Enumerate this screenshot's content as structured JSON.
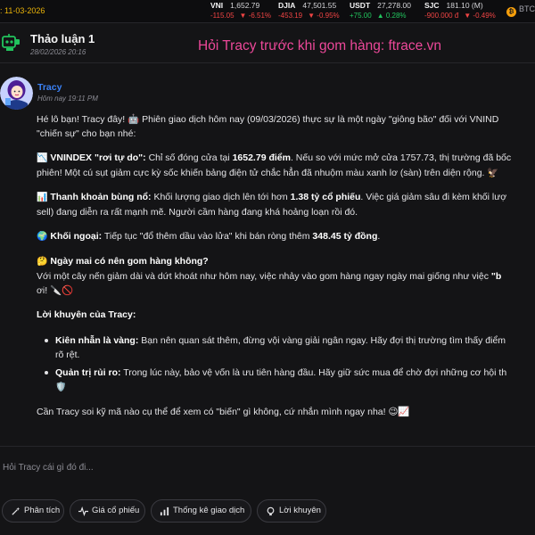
{
  "ticker": {
    "date": ": 11-03-2026",
    "items": [
      {
        "symbol": "VNI",
        "price": "1,652.79",
        "change": "-115.05",
        "pct": "▼ -6.51%",
        "direction": "down"
      },
      {
        "symbol": "DJIA",
        "price": "47,501.55",
        "change": "-453.19",
        "pct": "▼ -0.95%",
        "direction": "down"
      },
      {
        "symbol": "USDT",
        "price": "27,278.00",
        "change": "+75.00",
        "pct": "▲ 0.28%",
        "direction": "up"
      },
      {
        "symbol": "SJC",
        "price": "181.10 (M)",
        "change": "-900.000 đ",
        "pct": "▼ -0.49%",
        "direction": "down"
      }
    ],
    "btc_label": "BTC"
  },
  "header": {
    "title": "Thảo luận 1",
    "date": "28/02/2026 20:16",
    "promo": "Hỏi Tracy trước khi gom hàng:  ftrace.vn"
  },
  "message": {
    "sender": "Tracy",
    "time": "Hôm nay 19:11 PM",
    "intro_1": "Hé lô bạn! Tracy đây! 🤖 Phiên giao dịch hôm nay (09/03/2026) thực sự là một ngày \"giông bão\" đối với VNIND",
    "intro_2": "\"chiến sự\" cho bạn nhé:",
    "vnindex": {
      "icon": "📉",
      "label": "VNINDEX \"rơi tự do\":",
      "t1": " Chỉ số đóng cửa tại ",
      "value": "1652.79 điểm",
      "t2": ". Nếu so với mức mở cửa 1757.73, thị trường đã bốc",
      "line2": "phiên! Một cú sụt giảm cực kỳ sốc khiến bảng điện tử chắc hẳn đã nhuộm màu xanh lơ (sàn) trên diện rộng. 🦅"
    },
    "liquidity": {
      "icon": "📊",
      "label": "Thanh khoản bùng nổ:",
      "t1": " Khối lượng giao dịch lên tới hơn ",
      "value": "1.38 tỷ cổ phiếu",
      "t2": ". Việc giá giảm sâu đi kèm khối lượ",
      "line2": "sell) đang diễn ra rất mạnh mẽ. Người cầm hàng đang khá hoảng loạn rồi đó."
    },
    "foreign": {
      "icon": "🌍",
      "label": "Khối ngoại:",
      "t1": " Tiếp tục \"đổ thêm dầu vào lửa\" khi bán ròng thêm ",
      "value": "348.45 tỷ đồng",
      "t2": "."
    },
    "question": {
      "icon": "🤔",
      "label": "Ngày mai có nên gom hàng không?",
      "line1": "Với một cây nến giảm dài và dứt khoát như hôm nay, việc nhảy vào gom hàng ngay ngày mai giống như việc ",
      "bold_tail": "\"b",
      "line2": "ơi! 🔪🚫"
    },
    "advice_title": "Lời khuyên của Tracy:",
    "advice": [
      {
        "label": "Kiên nhẫn là vàng:",
        "line1": " Bạn nên quan sát thêm, đừng vội vàng giải ngân ngay. Hãy đợi thị trường tìm thấy điểm",
        "line2": "rõ rệt."
      },
      {
        "label": "Quản trị rủi ro:",
        "line1": " Trong lúc này, bảo vệ vốn là ưu tiên hàng đầu. Hãy giữ sức mua để chờ đợi những cơ hội th",
        "line2": "🛡️"
      }
    ],
    "closing": "Cần Tracy soi kỹ mã nào cụ thể để xem có \"biến\" gì không, cứ nhắn mình ngay nha! 😉📈"
  },
  "input": {
    "placeholder": "Hỏi Tracy cái gì đó đi..."
  },
  "chips": [
    {
      "label": "Phân tích",
      "icon": "wand-icon"
    },
    {
      "label": "Giá cổ phiếu",
      "icon": "pulse-icon"
    },
    {
      "label": "Thống kê giao dịch",
      "icon": "bar-chart-icon"
    },
    {
      "label": "Lời khuyên",
      "icon": "lightbulb-icon"
    }
  ],
  "colors": {
    "accent": "#3b82f6",
    "promo": "#ec4899",
    "down": "#ef4444",
    "up": "#22c55e",
    "date": "#eab308",
    "bot_icon": "#22c55e"
  }
}
